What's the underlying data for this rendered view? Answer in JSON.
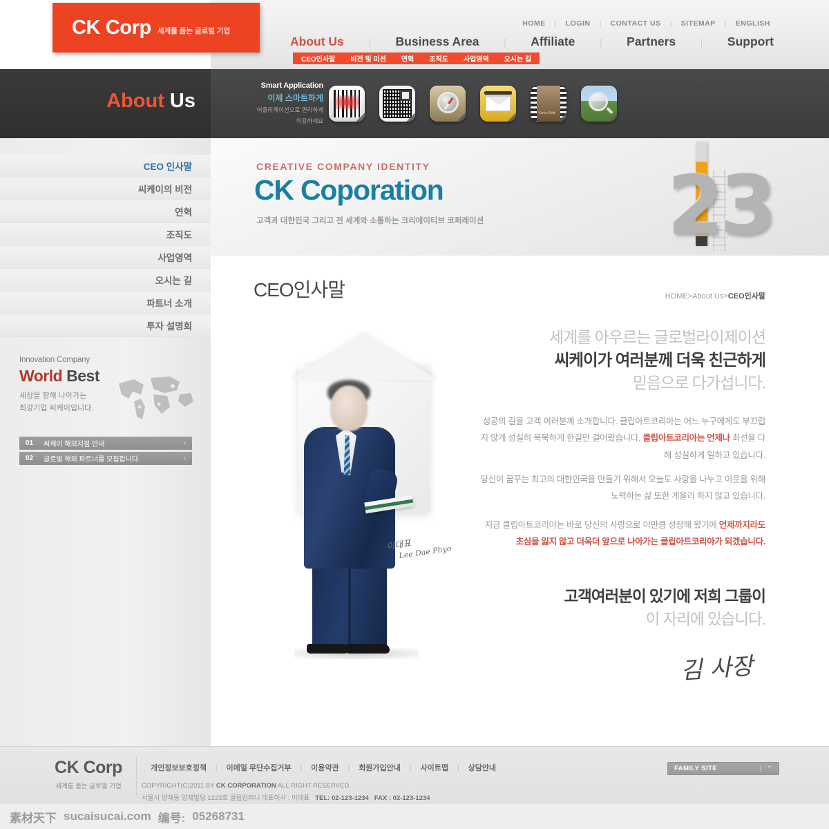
{
  "header": {
    "logo": {
      "name": "CK Corp",
      "tagline": "세계를 품는 글로벌 기업"
    },
    "utility_nav": [
      "HOME",
      "LOGIN",
      "CONTACT US",
      "SITEMAP",
      "ENGLISH"
    ],
    "main_nav": [
      {
        "label": "About Us",
        "active": true
      },
      {
        "label": "Business Area",
        "active": false
      },
      {
        "label": "Affiliate",
        "active": false
      },
      {
        "label": "Partners",
        "active": false
      },
      {
        "label": "Support",
        "active": false
      }
    ],
    "sub_nav": [
      "CEO인사말",
      "비전 및 미션",
      "연혁",
      "조직도",
      "사업영역",
      "오시는 길"
    ]
  },
  "section_band": {
    "title_accent": "About",
    "title_rest": "Us",
    "smart_app": {
      "title": "Smart Application",
      "subtitle": "이제 스마트하게",
      "desc_line1": "어플리케이션으로 편리하게",
      "desc_line2": "이용하세요"
    },
    "app_icons": [
      {
        "name": "barcode-icon",
        "label": "Barcode"
      },
      {
        "name": "qr-code-icon",
        "label": "QR Code"
      },
      {
        "name": "compass-icon",
        "label": "Compass"
      },
      {
        "name": "mail-icon",
        "label": "Mail"
      },
      {
        "name": "video-edit-icon",
        "label": "Vicou Edit"
      },
      {
        "name": "search-magnifier-icon",
        "label": "Search"
      }
    ]
  },
  "sidebar": {
    "menu": [
      {
        "label": "CEO 인사말",
        "active": true
      },
      {
        "label": "씨케이의 비전",
        "active": false
      },
      {
        "label": "연혁",
        "active": false
      },
      {
        "label": "조직도",
        "active": false
      },
      {
        "label": "사업영역",
        "active": false
      },
      {
        "label": "오시는 길",
        "active": false
      },
      {
        "label": "파트너 소개",
        "active": false
      },
      {
        "label": "투자 설명회",
        "active": false
      }
    ],
    "promo": {
      "eyebrow": "Innovation Company",
      "title_accent": "World",
      "title_rest": "Best",
      "desc_line1": "세상을 향해 나아가는",
      "desc_line2": "최강기업 씨케이입니다.",
      "items": [
        {
          "num": "01",
          "text": "씨케이 해외지점 안내",
          "arrow": "›"
        },
        {
          "num": "02",
          "text": "글로벌 해외 파트너를 모집합니다.",
          "arrow": "›"
        }
      ]
    }
  },
  "banner": {
    "eyebrow": "CREATIVE COMPANY IDENTITY",
    "title": "CK Coporation",
    "subtitle": "고객과 대한민국 그리고 전 세계와 소통하는 크리에이티브 코퍼레이션",
    "graphic_number": "23"
  },
  "content": {
    "page_title": "CEO인사말",
    "breadcrumb_prefix": "HOME>About Us>",
    "breadcrumb_current": "CEO인사말",
    "headline": {
      "line1": "세계를 아우르는 글로벌라이제이션",
      "line2": "씨케이가 여러분께 더욱 친근하게",
      "line3": "믿음으로 다가섭니다."
    },
    "paragraphs": [
      {
        "plain_before": "성공의 길을 고객 여러분께 소개합니다. 클립아트코리아는 어느 누구에게도 부끄럽지 않게 성실히 묵묵하게 한길만 걸어왔습니다. ",
        "emphasis": "클립아트코리아는 언제나",
        "plain_after": " 최선을 다해 성실하게 일하고 있습니다."
      },
      {
        "plain_before": "당신이 꿈꾸는 최고의 대한민국을 만들기 위해서 오늘도 사랑을 나누고 이웃을 위해 노력하는 삶 또한 게을리 하지 않고 있습니다.",
        "emphasis": "",
        "plain_after": ""
      },
      {
        "plain_before": "지금 클립아트코리아는 바로 당신의 사랑으로 이만큼 성장해 왔기에 ",
        "emphasis": "언제까지라도 초심을 잃지 않고 더욱더 앞으로 나아가는 클립아트코리아가 되겠습니다.",
        "plain_after": ""
      }
    ],
    "closing": {
      "line1": "고객여러분이 있기에 저희 그룹이",
      "line2": "이 자리에 있습니다."
    },
    "signature": "김 사장",
    "photo_autograph_kr": "이대표",
    "photo_autograph_en": "Lee Dae Phyo"
  },
  "footer": {
    "logo_name": "CK Corp",
    "logo_sub": "세계를 품는 글로벌 기업",
    "links": [
      "개인정보보호정책",
      "이메일 무단수집거부",
      "이용약관",
      "회원가입안내",
      "사이트맵",
      "상담안내"
    ],
    "copyright_prefix": "COPYRIGHT(C)2011 BY ",
    "copyright_company": "CK CORPORATION",
    "copyright_suffix": " ALL RIGHT RESERVED.",
    "address": "서울시 양재동 양재빌딩 1223호 클립컴퍼니  대표이사 : 이대표",
    "tel": "TEL: 02-123-1234",
    "fax": "FAX : 02-123-1234",
    "family_site_label": "FAMILY SITE",
    "family_site_caret": "⌃"
  },
  "watermark": {
    "brand": "素材天下",
    "site": "sucaisucai.com",
    "id_label": "编号:",
    "id_value": "05268731"
  },
  "colors": {
    "brand_red": "#ee4323",
    "nav_active": "#cf4f42",
    "banner_blue": "#1b7fa3",
    "sidebar_active": "#2f6ea5",
    "emphasis_red": "#cf5346"
  }
}
